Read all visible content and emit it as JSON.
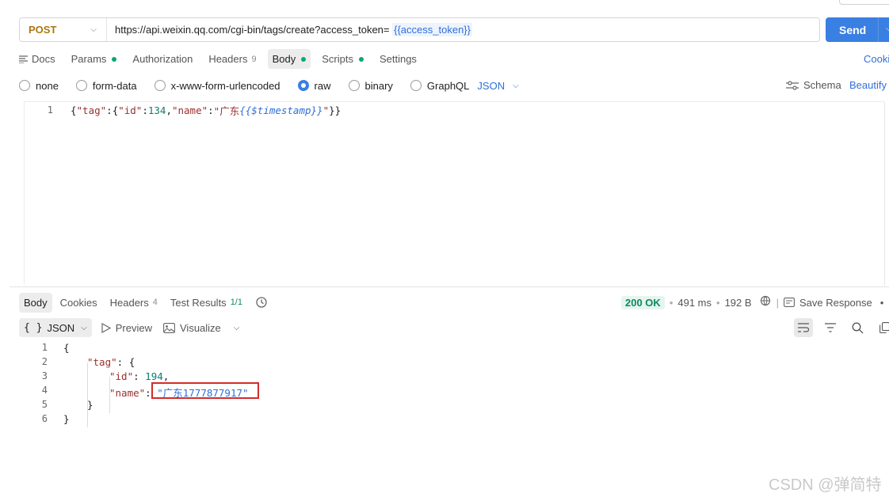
{
  "request": {
    "method": "POST",
    "url_base": "https://api.weixin.qq.com/cgi-bin/tags/create?access_token=",
    "url_variable": "{{access_token}}",
    "send_label": "Send"
  },
  "request_tabs": [
    {
      "label": "Docs"
    },
    {
      "label": "Params"
    },
    {
      "label": "Authorization"
    },
    {
      "label": "Headers",
      "count": "9"
    },
    {
      "label": "Body"
    },
    {
      "label": "Scripts"
    },
    {
      "label": "Settings"
    }
  ],
  "cookies_label": "Cooki",
  "body_types": [
    "none",
    "form-data",
    "x-www-form-urlencoded",
    "raw",
    "binary",
    "GraphQL"
  ],
  "body_selected": "raw",
  "raw_format": "JSON",
  "schema_label": "Schema",
  "beautify_label": "Beautify",
  "request_body": {
    "line_number": "1",
    "tag_key": "\"tag\"",
    "id_key": "\"id\"",
    "id_value": "134",
    "name_key": "\"name\"",
    "name_prefix": "\"广东",
    "name_template": "{{$timestamp}}",
    "name_suffix": "\""
  },
  "response_tabs": [
    {
      "label": "Body"
    },
    {
      "label": "Cookies"
    },
    {
      "label": "Headers",
      "count": "4"
    },
    {
      "label": "Test Results",
      "count": "1/1"
    }
  ],
  "response_status": {
    "code": "200 OK",
    "time": "491 ms",
    "size": "192 B",
    "save_label": "Save Response"
  },
  "response_toolbar": {
    "format": "JSON",
    "preview": "Preview",
    "visualize": "Visualize"
  },
  "response_body": {
    "line_numbers": [
      "1",
      "2",
      "3",
      "4",
      "5",
      "6"
    ],
    "open_brace": "{",
    "tag_key": "\"tag\"",
    "id_key": "\"id\"",
    "id_value": "194",
    "name_key": "\"name\"",
    "name_value": "\"广东1777877917\"",
    "inner_close": "}",
    "outer_close": "}"
  },
  "watermark": "CSDN @弹简特",
  "colors": {
    "accent": "#3a7fe2",
    "method": "#a9780f",
    "status_ok": "#0a8a5f",
    "highlight": "#d42b2b"
  }
}
